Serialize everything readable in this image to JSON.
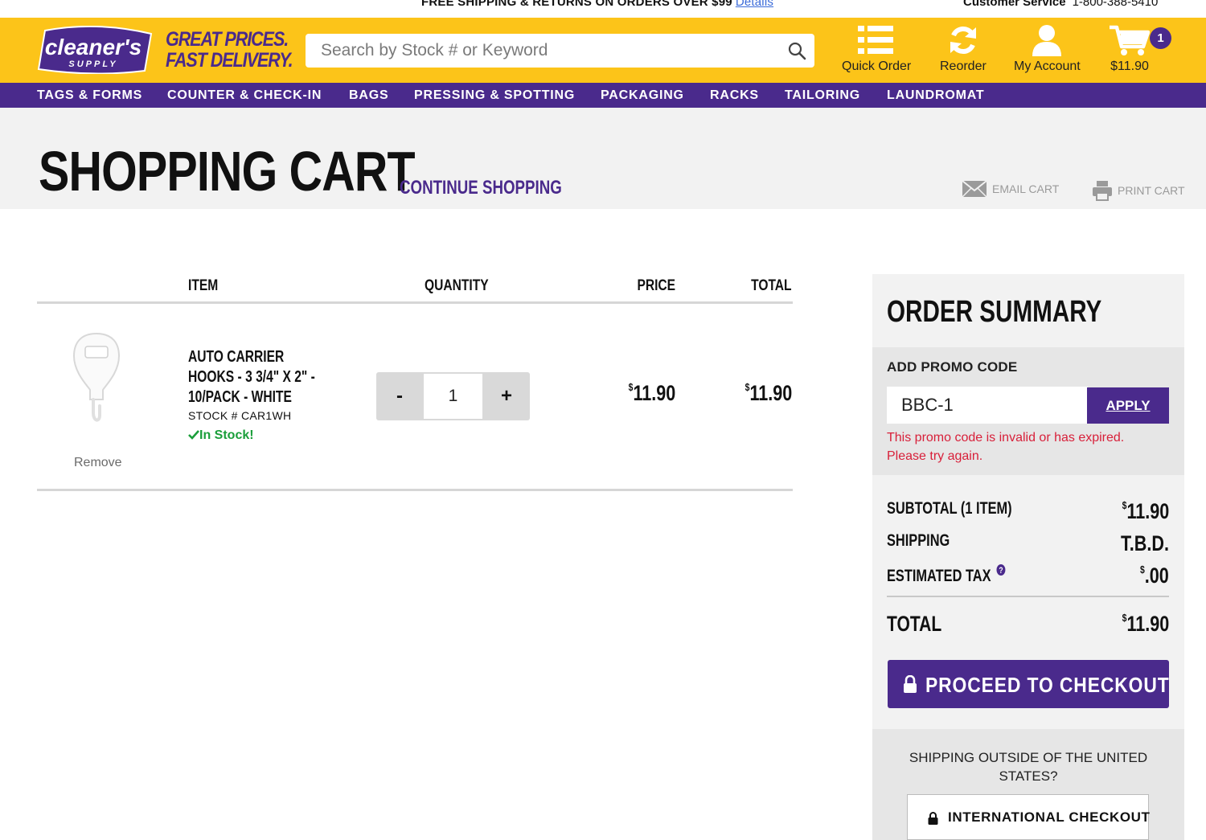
{
  "topbar": {
    "promo_text": "FREE SHIPPING & RETURNS ON ORDERS OVER $99",
    "promo_link": "Details",
    "customer_service_label": "Customer Service",
    "customer_service_phone": "1-800-388-5410"
  },
  "header": {
    "logo_text": "cleaner's",
    "logo_subtext": "SUPPLY",
    "tagline_1": "GREAT PRICES.",
    "tagline_2": "FAST DELIVERY.",
    "search_placeholder": "Search by Stock # or Keyword",
    "quick_order": "Quick Order",
    "reorder": "Reorder",
    "my_account": "My Account",
    "cart_total": "$11.90",
    "cart_count": "1",
    "brand_color": "#fcc419",
    "accent_color": "#4a2a8c"
  },
  "nav": {
    "items": [
      "TAGS & FORMS",
      "COUNTER & CHECK-IN",
      "BAGS",
      "PRESSING & SPOTTING",
      "PACKAGING",
      "RACKS",
      "TAILORING",
      "LAUNDROMAT"
    ]
  },
  "page": {
    "title": "SHOPPING CART",
    "continue_shopping": "CONTINUE SHOPPING",
    "email_cart": "EMAIL CART",
    "print_cart": "PRINT CART"
  },
  "cart": {
    "headers": {
      "item": "ITEM",
      "quantity": "QUANTITY",
      "price": "PRICE",
      "total": "TOTAL"
    },
    "items": [
      {
        "name": "AUTO CARRIER HOOKS - 3 3/4\" X 2\" - 10/PACK - WHITE",
        "stock": "STOCK # CAR1WH",
        "availability": "In Stock!",
        "quantity": "1",
        "price_symbol": "$",
        "price": "11.90",
        "total_symbol": "$",
        "total": "11.90",
        "remove_label": "Remove",
        "minus_label": "-",
        "plus_label": "+"
      }
    ]
  },
  "summary": {
    "title": "ORDER SUMMARY",
    "promo_label": "ADD PROMO CODE",
    "promo_value": "BBC-1",
    "apply_label": "APPLY",
    "promo_error": "This promo code is invalid or has expired. Please try again.",
    "subtotal_label": "SUBTOTAL (1 ITEM)",
    "subtotal_symbol": "$",
    "subtotal_value": "11.90",
    "shipping_label": "SHIPPING",
    "shipping_value": "T.B.D.",
    "tax_label": "ESTIMATED TAX",
    "tax_symbol": "$",
    "tax_value": ".00",
    "total_label": "TOTAL",
    "total_symbol": "$",
    "total_value": "11.90",
    "checkout_label": "PROCEED TO CHECKOUT",
    "intl_question": "SHIPPING OUTSIDE OF THE UNITED STATES?",
    "intl_checkout_label": "INTERNATIONAL CHECKOUT",
    "error_color": "#d8203a",
    "in_stock_color": "#1a9e3a"
  }
}
